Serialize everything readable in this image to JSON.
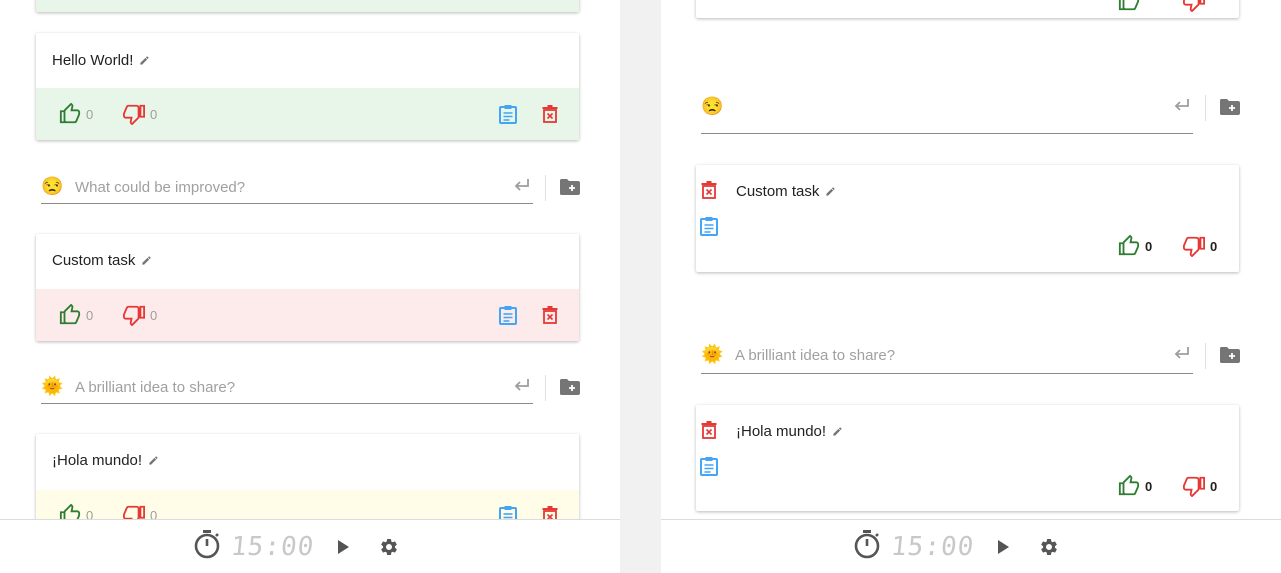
{
  "colors": {
    "up": "#2e7d32",
    "down": "#e53935",
    "copy": "#42a5f5",
    "delete": "#e53935",
    "muted_icon": "#757575"
  },
  "left": {
    "cards": [
      {
        "text": "Hello World!",
        "up": "0",
        "down": "0"
      },
      {
        "text": "Custom task",
        "up": "0",
        "down": "0"
      },
      {
        "text": "¡Hola mundo!",
        "up": "0",
        "down": "0"
      }
    ],
    "inputs": [
      {
        "emoji": "😒",
        "placeholder": "What could be improved?"
      },
      {
        "emoji": "🌞",
        "placeholder": "A brilliant idea to share?"
      }
    ],
    "timer": "15:00"
  },
  "right": {
    "top_card": {
      "up": "",
      "down": ""
    },
    "inputs": [
      {
        "emoji": "😒",
        "placeholder": ""
      },
      {
        "emoji": "🌞",
        "placeholder": "A brilliant idea to share?"
      }
    ],
    "cards": [
      {
        "text": "Custom task",
        "up": "0",
        "down": "0"
      },
      {
        "text": "¡Hola mundo!",
        "up": "0",
        "down": "0"
      }
    ],
    "timer": "15:00"
  }
}
